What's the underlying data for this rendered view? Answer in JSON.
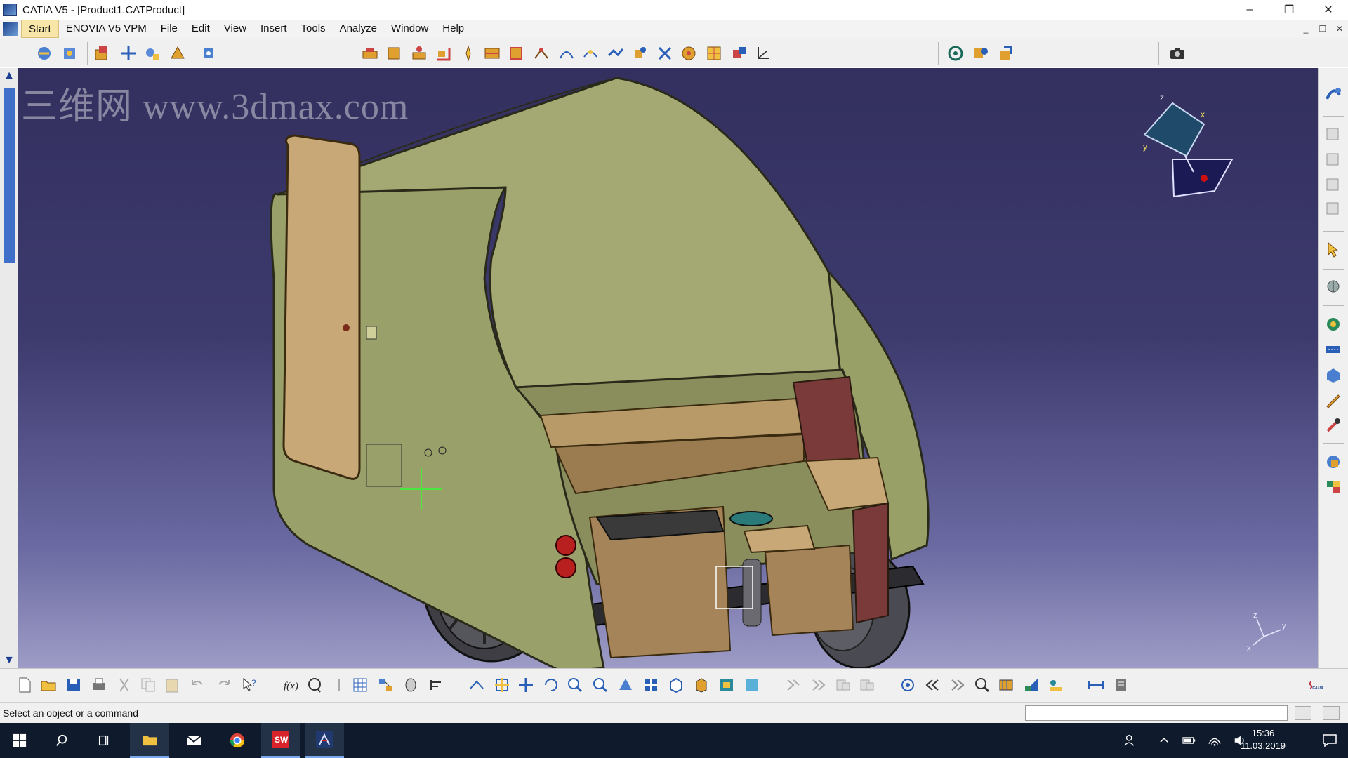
{
  "window": {
    "title": "CATIA V5 - [Product1.CATProduct]",
    "controls": [
      "–",
      "❐",
      "✕"
    ]
  },
  "menu": {
    "items": [
      "Start",
      "ENOVIA V5 VPM",
      "File",
      "Edit",
      "View",
      "Insert",
      "Tools",
      "Analyze",
      "Window",
      "Help"
    ]
  },
  "watermark": "三维网 www.3dmax.com",
  "viewport": {
    "compass_axes": [
      "z",
      "x",
      "y"
    ],
    "triad_axes": [
      "z",
      "y",
      "x"
    ],
    "background_top": "#33305f",
    "background_bottom": "#9d9cc6"
  },
  "status": {
    "message": "Select an object or a command",
    "command_input_value": ""
  },
  "brand": {
    "logo_text": "CATIA"
  },
  "taskbar": {
    "time": "15:36",
    "date": "11.03.2019",
    "solidworks_badge": "SW"
  }
}
